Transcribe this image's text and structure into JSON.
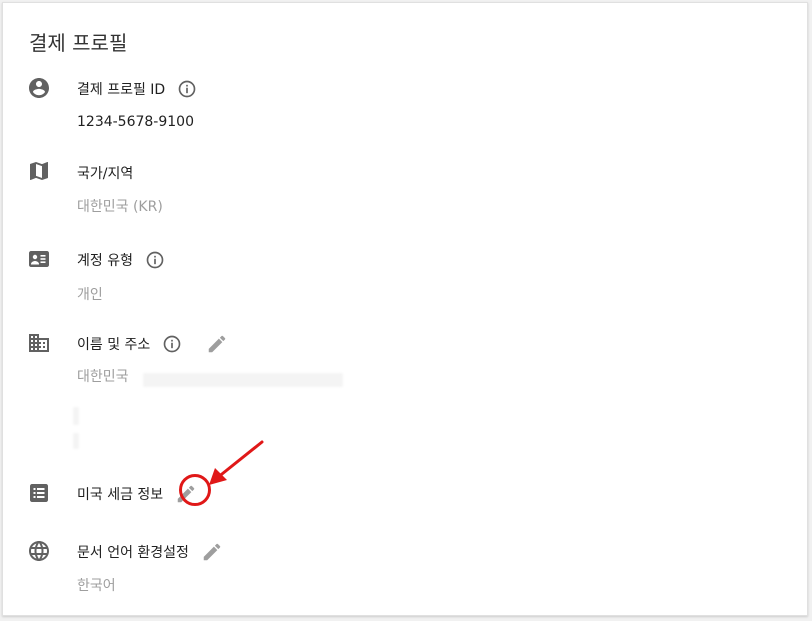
{
  "page": {
    "title": "결제 프로필"
  },
  "sections": [
    {
      "id": "profile-id",
      "icon": "account-circle-icon",
      "label": "결제 프로필 ID",
      "value": "1234-5678-9100",
      "has_info": true,
      "has_edit": false
    },
    {
      "id": "country",
      "icon": "map-icon",
      "label": "국가/지역",
      "value": "대한민국 (KR)",
      "has_info": false,
      "has_edit": false
    },
    {
      "id": "account-type",
      "icon": "contact-card-icon",
      "label": "계정 유형",
      "value": "개인",
      "has_info": true,
      "has_edit": false
    },
    {
      "id": "name-address",
      "icon": "building-icon",
      "label": "이름 및 주소",
      "value": "대한민국",
      "has_info": true,
      "has_edit": true
    },
    {
      "id": "us-tax",
      "icon": "list-icon",
      "label": "미국 세금 정보",
      "has_info": false,
      "has_edit": true
    },
    {
      "id": "language",
      "icon": "globe-icon",
      "label": "문서 언어 환경설정",
      "value": "한국어",
      "has_info": false,
      "has_edit": true
    }
  ],
  "colors": {
    "icon": "#616161",
    "muted_icon": "#9e9e9e",
    "annotation": "#e01818"
  }
}
